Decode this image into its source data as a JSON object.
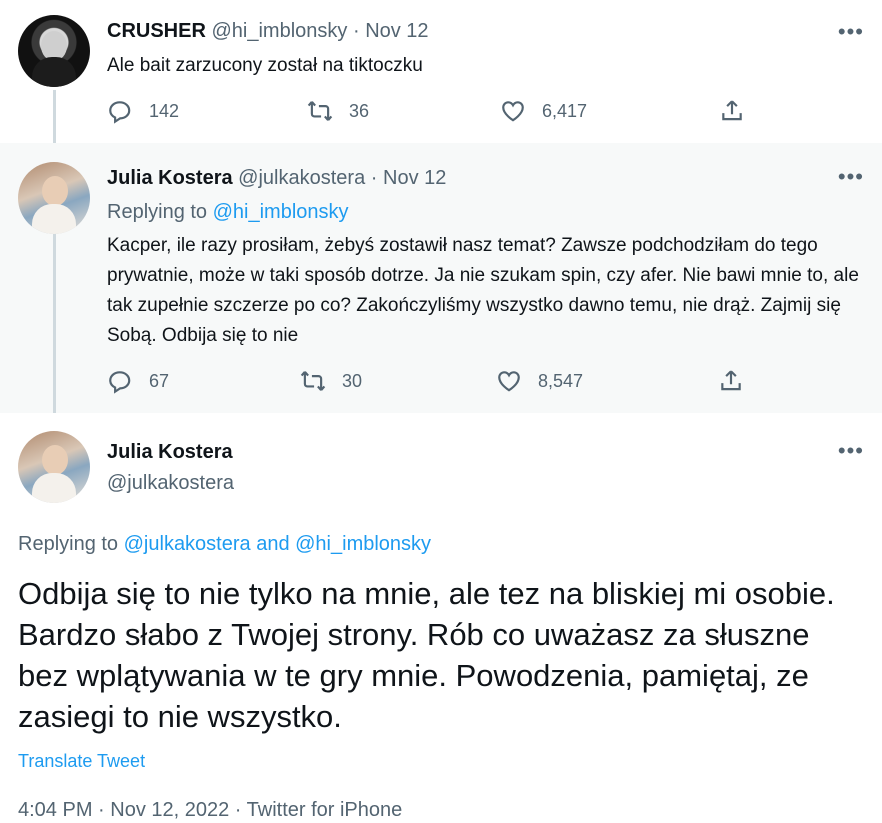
{
  "tweets": [
    {
      "name": "CRUSHER",
      "handle": "@hi_imblonsky",
      "sep": "·",
      "date": "Nov 12",
      "text": "Ale bait zarzucony został na tiktoczku",
      "more": "•••",
      "replies": "142",
      "retweets": "36",
      "likes": "6,417"
    },
    {
      "name": "Julia Kostera",
      "handle": "@julkakostera",
      "sep": "·",
      "date": "Nov 12",
      "replying_prefix": "Replying to",
      "replying_to": "@hi_imblonsky",
      "text": "Kacper, ile razy prosiłam, żebyś zostawił nasz temat? Zawsze podchodziłam do tego prywatnie, może w taki sposób dotrze. Ja nie szukam spin, czy afer. Nie bawi mnie to, ale tak zupełnie szczerze po co? Zakończyliśmy wszystko dawno temu, nie drąż. Zajmij się Sobą. Odbija się to nie",
      "more": "•••",
      "replies": "67",
      "retweets": "30",
      "likes": "8,547"
    },
    {
      "name": "Julia Kostera",
      "handle": "@julkakostera",
      "more": "•••",
      "replying_prefix": "Replying to",
      "replying_to": "@julkakostera and @hi_imblonsky",
      "text": "Odbija się to nie tylko na mnie, ale tez na bliskiej mi osobie. Bardzo słabo z Twojej strony. Rób co uważasz za słuszne bez wplątywania w te gry mnie. Powodzenia, pamiętaj, ze zasiegi to nie wszystko.",
      "translate": "Translate Tweet",
      "meta": "4:04 PM · Nov 12, 2022 · Twitter for iPhone"
    }
  ],
  "colors": {
    "link": "#1d9bf0",
    "muted": "#536471",
    "highlight_bg": "#f7f9f9",
    "thread_line": "#cfd9de"
  }
}
